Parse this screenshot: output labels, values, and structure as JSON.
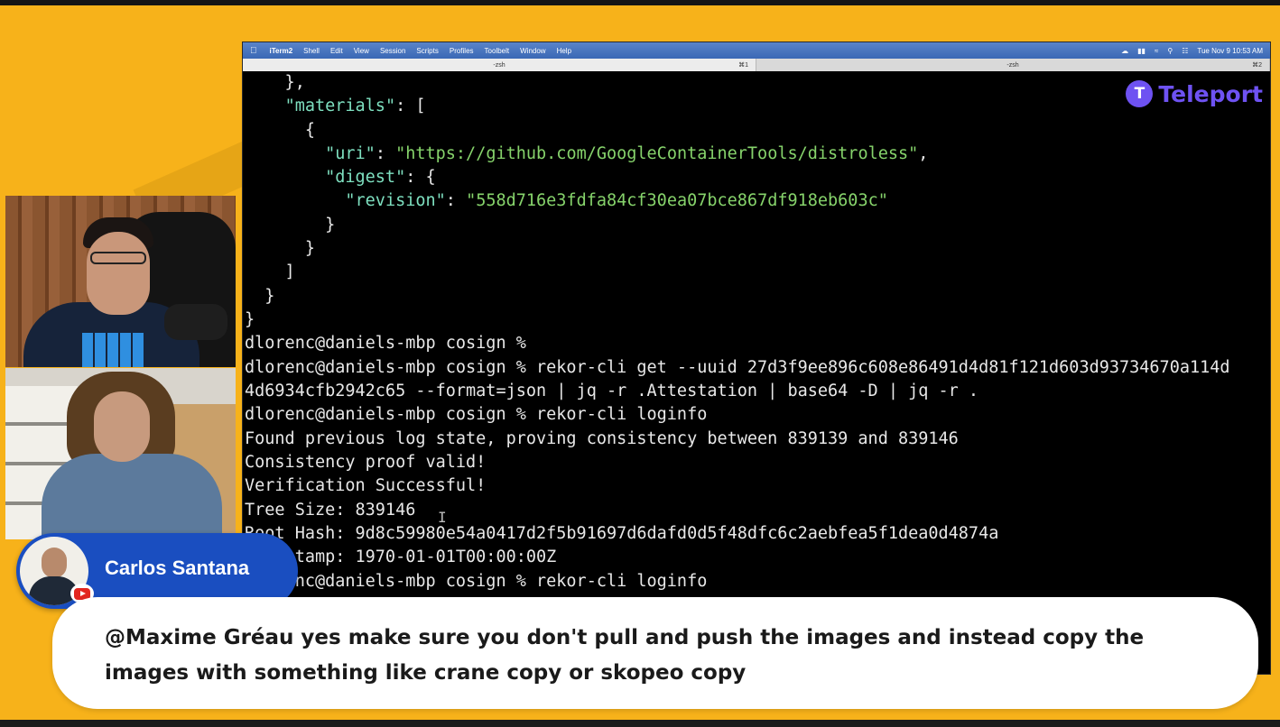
{
  "menubar": {
    "items": [
      "iTerm2",
      "Shell",
      "Edit",
      "View",
      "Session",
      "Scripts",
      "Profiles",
      "Toolbelt",
      "Window",
      "Help"
    ],
    "clock": "Tue Nov 9  10:53 AM"
  },
  "tabs": [
    {
      "label": "-zsh",
      "shortcut": "⌘1"
    },
    {
      "label": "-zsh",
      "shortcut": "⌘2"
    }
  ],
  "logo": {
    "brand": "Teleport"
  },
  "terminal_lines": [
    "    },",
    "    \"materials\": [",
    "      {",
    "        \"uri\": \"https://github.com/GoogleContainerTools/distroless\",",
    "        \"digest\": {",
    "          \"revision\": \"558d716e3fdfa84cf30ea07bce867df918eb603c\"",
    "        }",
    "      }",
    "    ]",
    "  }",
    "}",
    "dlorenc@daniels-mbp cosign %",
    "dlorenc@daniels-mbp cosign % rekor-cli get --uuid 27d3f9ee896c608e86491d4d81f121d603d93734670a114d",
    "4d6934cfb2942c65 --format=json | jq -r .Attestation | base64 -D | jq -r .",
    "dlorenc@daniels-mbp cosign % rekor-cli loginfo",
    "Found previous log state, proving consistency between 839139 and 839146",
    "Consistency proof valid!",
    "Verification Successful!",
    "Tree Size: 839146",
    "Root Hash: 9d8c59980e54a0417d2f5b91697d6dafd0d5f48dfc6c2aebfea5f1dea0d4874a",
    "Timestamp: 1970-01-01T00:00:00Z",
    "dlorenc@daniels-mbp cosign % rekor-cli loginfo"
  ],
  "speaker": {
    "name": "Carlos Santana"
  },
  "chat": {
    "message": "@Maxime Gréau yes make sure you don't pull and push the images and instead copy the images with something like crane copy or skopeo copy"
  },
  "colors": {
    "background": "#f7b21a",
    "accent": "#1a4ec0",
    "terminal_key": "#7ee0c0",
    "terminal_string": "#86d36b",
    "teleport": "#6e52f2"
  }
}
